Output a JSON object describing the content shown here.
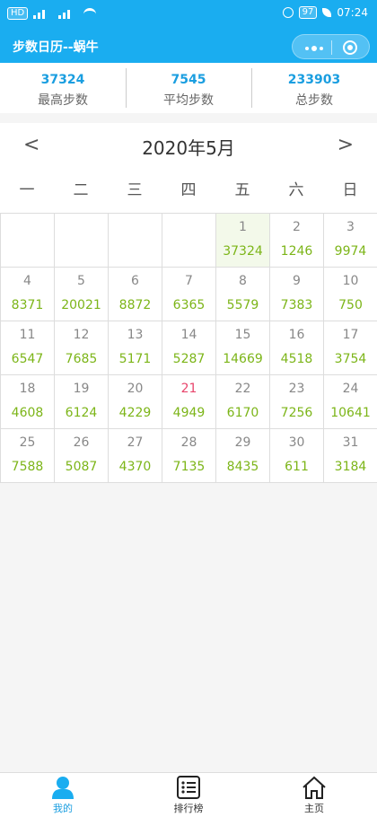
{
  "status": {
    "time": "07:24",
    "battery": "97"
  },
  "header": {
    "title": "步数日历--蜗牛"
  },
  "stats": [
    {
      "value": "37324",
      "label": "最高步数"
    },
    {
      "value": "7545",
      "label": "平均步数"
    },
    {
      "value": "233903",
      "label": "总步数"
    }
  ],
  "calendar": {
    "prev": "<",
    "month": "2020年5月",
    "next": ">",
    "weekdays": [
      "一",
      "二",
      "三",
      "四",
      "五",
      "六",
      "日"
    ],
    "days": [
      {
        "d": "",
        "s": ""
      },
      {
        "d": "",
        "s": ""
      },
      {
        "d": "",
        "s": ""
      },
      {
        "d": "",
        "s": ""
      },
      {
        "d": "1",
        "s": "37324"
      },
      {
        "d": "2",
        "s": "1246"
      },
      {
        "d": "3",
        "s": "9974"
      },
      {
        "d": "4",
        "s": "8371"
      },
      {
        "d": "5",
        "s": "20021"
      },
      {
        "d": "6",
        "s": "8872"
      },
      {
        "d": "7",
        "s": "6365"
      },
      {
        "d": "8",
        "s": "5579"
      },
      {
        "d": "9",
        "s": "7383"
      },
      {
        "d": "10",
        "s": "750"
      },
      {
        "d": "11",
        "s": "6547"
      },
      {
        "d": "12",
        "s": "7685"
      },
      {
        "d": "13",
        "s": "5171"
      },
      {
        "d": "14",
        "s": "5287"
      },
      {
        "d": "15",
        "s": "14669"
      },
      {
        "d": "16",
        "s": "4518"
      },
      {
        "d": "17",
        "s": "3754"
      },
      {
        "d": "18",
        "s": "4608"
      },
      {
        "d": "19",
        "s": "6124"
      },
      {
        "d": "20",
        "s": "4229"
      },
      {
        "d": "21",
        "s": "4949"
      },
      {
        "d": "22",
        "s": "6170"
      },
      {
        "d": "23",
        "s": "7256"
      },
      {
        "d": "24",
        "s": "10641"
      },
      {
        "d": "25",
        "s": "7588"
      },
      {
        "d": "26",
        "s": "5087"
      },
      {
        "d": "27",
        "s": "4370"
      },
      {
        "d": "28",
        "s": "7135"
      },
      {
        "d": "29",
        "s": "8435"
      },
      {
        "d": "30",
        "s": "611"
      },
      {
        "d": "31",
        "s": "3184"
      }
    ]
  },
  "tabs": [
    {
      "label": "我的",
      "icon": "person-icon"
    },
    {
      "label": "排行榜",
      "icon": "list-icon"
    },
    {
      "label": "主页",
      "icon": "home-icon"
    }
  ],
  "colors": {
    "accent": "#1aadf0",
    "steps": "#7cb518",
    "highlight": "#e8456c"
  }
}
